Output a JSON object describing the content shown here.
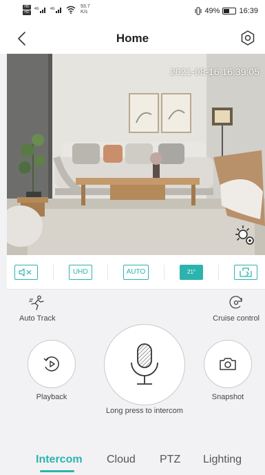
{
  "status_bar": {
    "hd_top": "HD",
    "hd_bottom": "HD",
    "signal_1": "4G",
    "signal_2": "4G",
    "speed_value": "93.7",
    "speed_unit": "K/s",
    "battery_percent": "49%",
    "time": "16:39",
    "battery_level": 0.49
  },
  "header": {
    "title": "Home"
  },
  "video": {
    "timestamp": "2021-08-16 16:39:05"
  },
  "toolbar": {
    "uhd_label": "UHD",
    "auto_label": "AUTO",
    "temperature_label": "21°"
  },
  "controls": {
    "auto_track_label": "Auto Track",
    "cruise_control_label": "Cruise control",
    "playback_label": "Playback",
    "snapshot_label": "Snapshot",
    "intercom_hint": "Long press to intercom"
  },
  "tabs": [
    {
      "label": "Intercom",
      "active": true
    },
    {
      "label": "Cloud",
      "active": false
    },
    {
      "label": "PTZ",
      "active": false
    },
    {
      "label": "Lighting",
      "active": false
    }
  ],
  "colors": {
    "accent": "#2cb3ad",
    "background": "#f2f2f4"
  }
}
